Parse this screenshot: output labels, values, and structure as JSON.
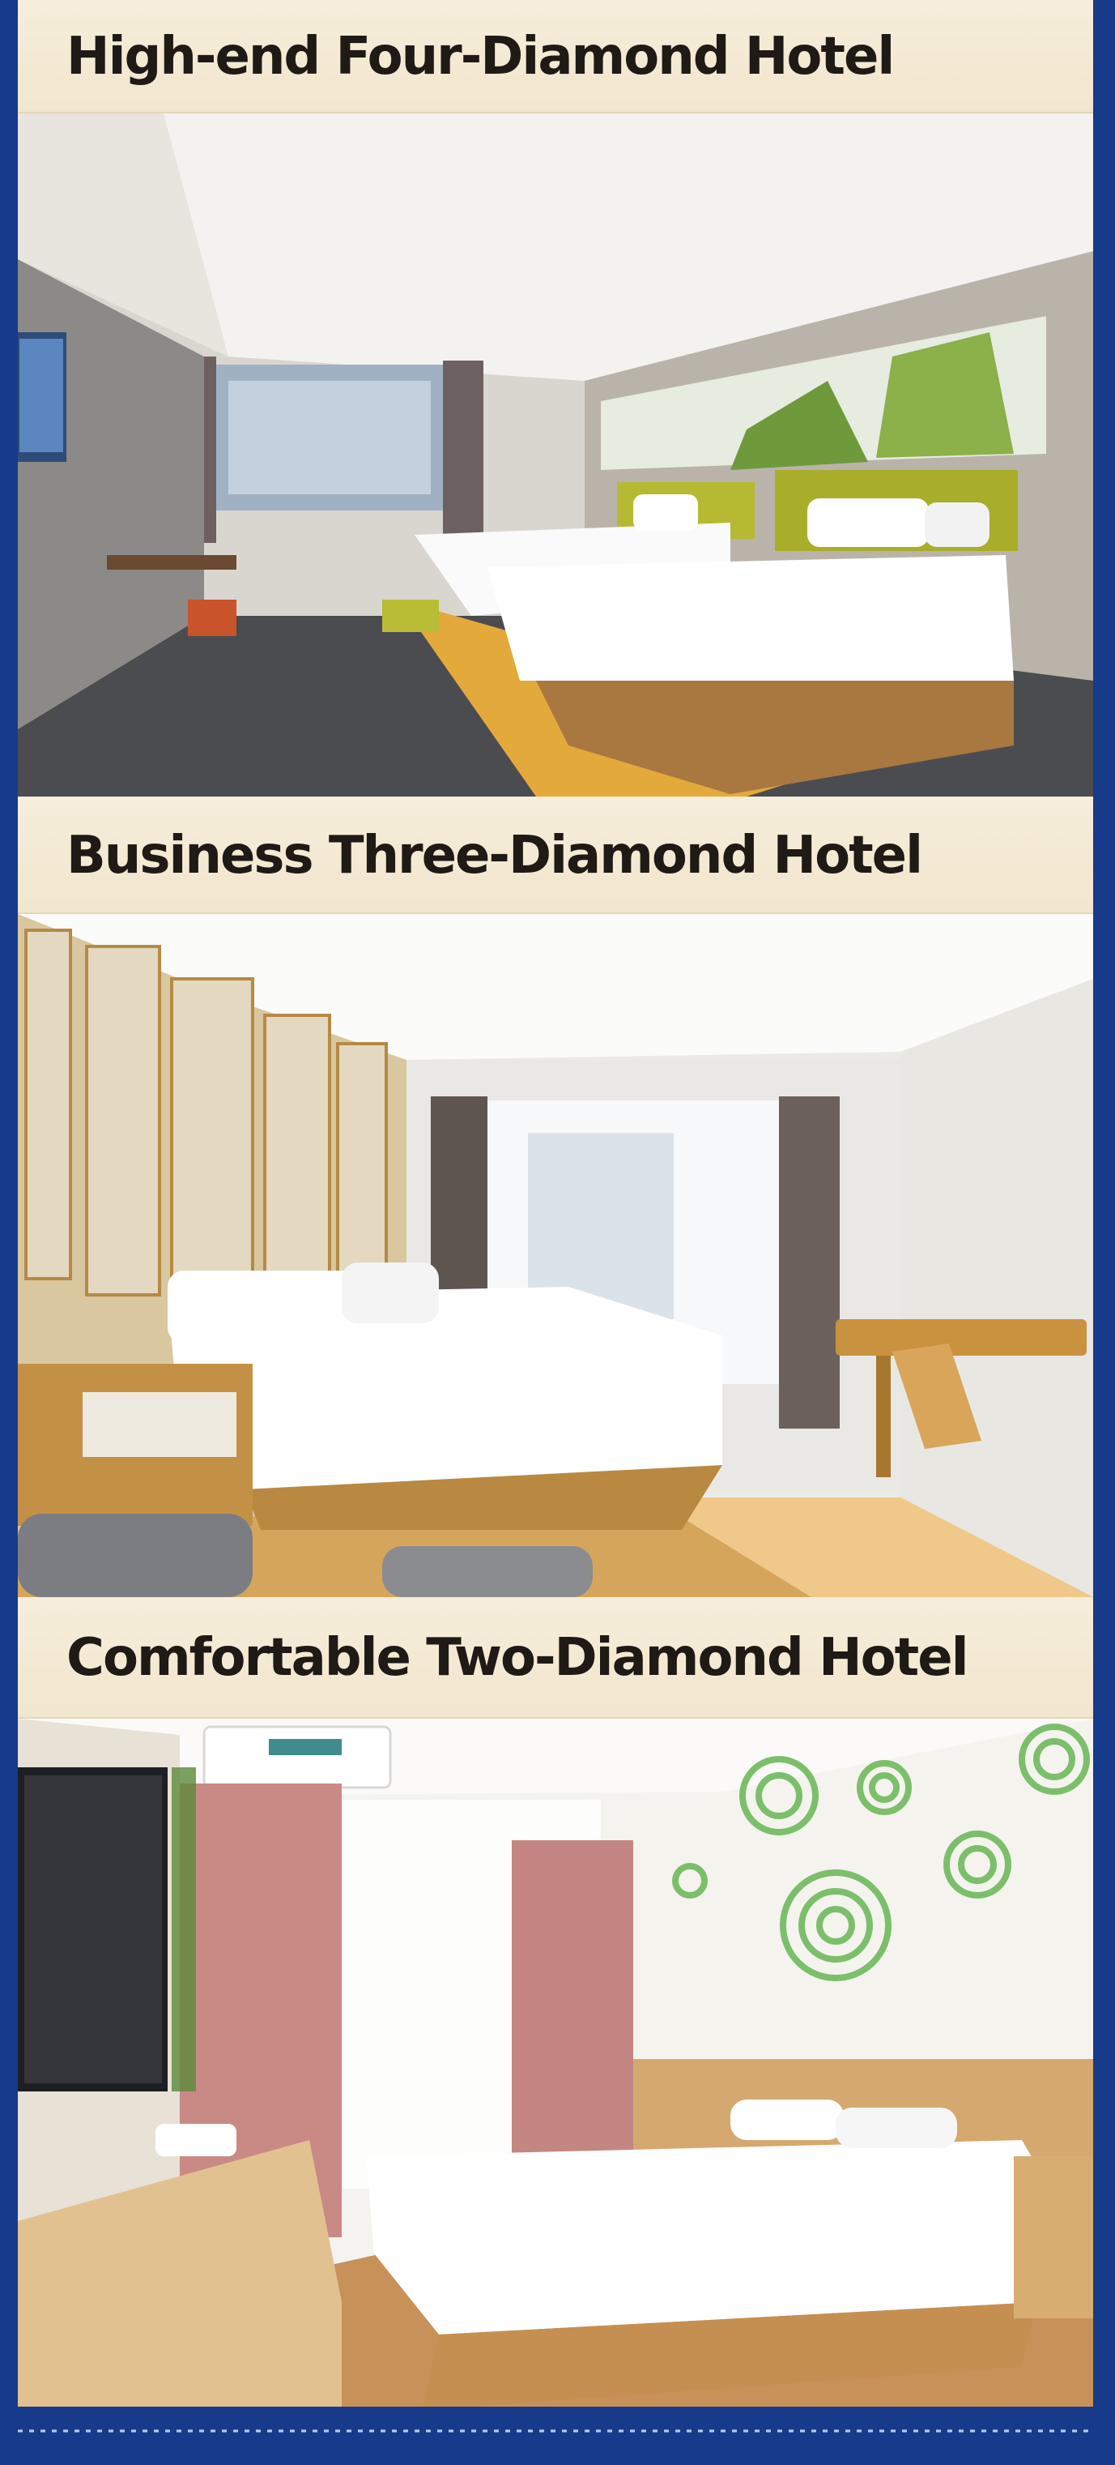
{
  "sections": [
    {
      "title": "High-end Four-Diamond Hotel",
      "photo_icon": "hotel-room-twin-beds"
    },
    {
      "title": "Business Three-Diamond Hotel",
      "photo_icon": "hotel-room-king-bed"
    },
    {
      "title": "Comfortable Two-Diamond Hotel",
      "photo_icon": "hotel-room-double-bed"
    }
  ],
  "colors": {
    "frame_blue": "#173a8a",
    "banner_cream": "#f3e9d3",
    "title_text": "#1f1a16"
  }
}
